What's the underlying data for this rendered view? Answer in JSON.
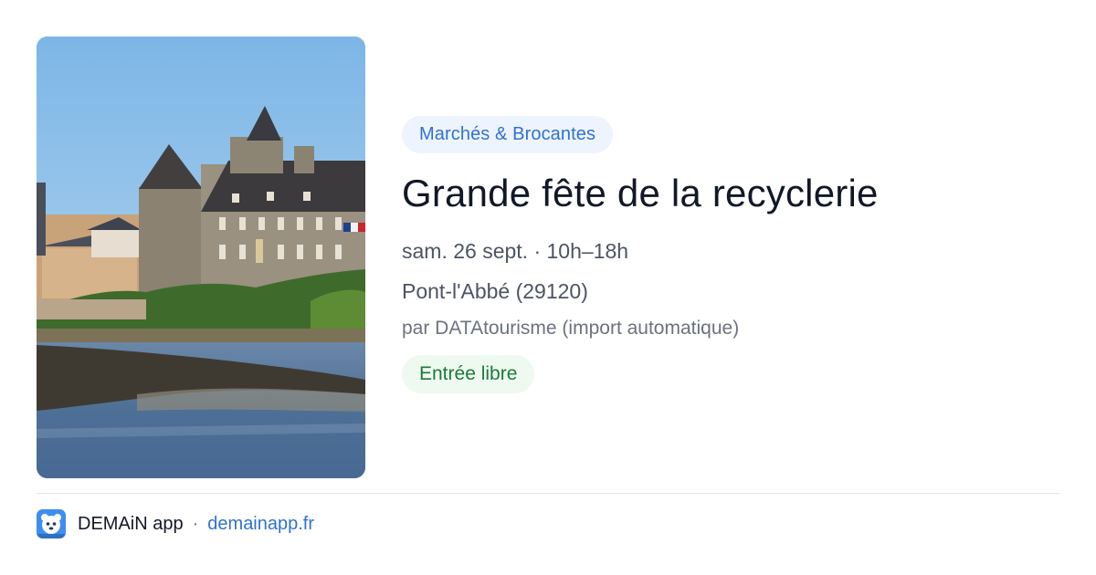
{
  "event": {
    "category": "Marchés & Brocantes",
    "title": "Grande fête de la recyclerie",
    "datetime": "sam. 26 sept. · 10h–18h",
    "location": "Pont-l'Abbé (29120)",
    "organizer": "par DATAtourisme (import automatique)",
    "price": "Entrée libre"
  },
  "footer": {
    "app_name": "DEMAiN app",
    "separator": "·",
    "link": "demainapp.fr",
    "logo_icon": "demain-app-logo-icon"
  },
  "colors": {
    "category_pill_bg": "#eef4fd",
    "category_pill_text": "#2f72d1",
    "price_pill_bg": "#eefaf0",
    "price_pill_text": "#1c7a3a",
    "link": "#2f72d1",
    "title": "#111827"
  }
}
